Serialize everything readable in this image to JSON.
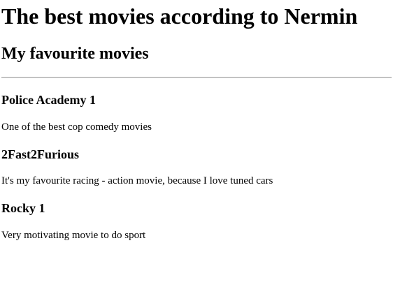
{
  "page": {
    "heading": "The best movies according to Nermin",
    "subheading": "My favourite movies"
  },
  "movies": [
    {
      "title": "Police Academy 1",
      "description": "One of the best cop comedy movies"
    },
    {
      "title": "2Fast2Furious",
      "description": "It's my favourite racing - action movie, because I love tuned cars"
    },
    {
      "title": "Rocky 1",
      "description": "Very motivating movie to do sport"
    }
  ]
}
